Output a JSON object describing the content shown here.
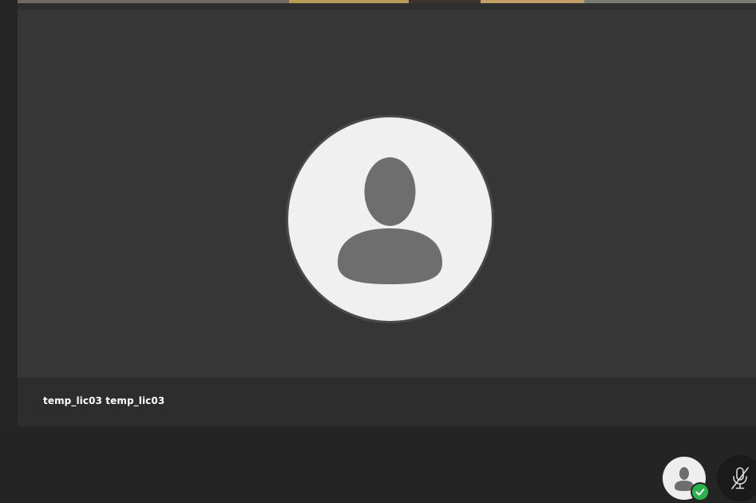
{
  "tile": {
    "participant_name": "temp_lic03 temp_lic03",
    "avatar_icon": "person-silhouette-icon"
  },
  "controls": {
    "self_avatar_icon": "person-silhouette-icon",
    "status_icon": "checkmark-icon",
    "status_color": "#2bb24c",
    "mic_icon": "microphone-muted-icon",
    "mic_state": "muted"
  },
  "colors": {
    "background": "#252525",
    "tile_background": "#363636",
    "caption_background": "#2d2d2d",
    "avatar_fill": "#f0f0f0",
    "silhouette": "#6e6e6e"
  }
}
